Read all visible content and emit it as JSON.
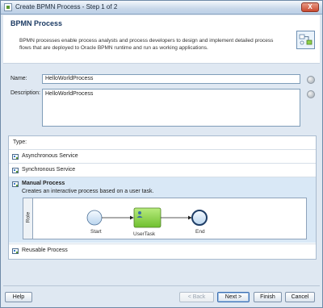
{
  "window": {
    "title": "Create BPMN Process - Step 1 of 2",
    "close_label": "X"
  },
  "header": {
    "title": "BPMN Process",
    "description": "BPMN processes enable process analysts and process developers to design and implement detailed process flows that are deployed to Oracle BPMN runtime and run as working applications."
  },
  "form": {
    "name_label": "Name:",
    "name_value": "HelloWorldProcess",
    "description_label": "Description:",
    "description_value": "HelloWorldProcess"
  },
  "type_panel": {
    "label": "Type:",
    "options": [
      {
        "label": "Asynchronous Service"
      },
      {
        "label": "Synchronous Service"
      },
      {
        "label": "Manual Process",
        "description": "Creates an interactive process based on a user task.",
        "selected": true
      },
      {
        "label": "Reusable Process"
      }
    ],
    "preview": {
      "lane_label": "Role",
      "start_label": "Start",
      "task_label": "UserTask",
      "end_label": "End"
    }
  },
  "footer": {
    "help": "Help",
    "back": "< Back",
    "next": "Next >",
    "finish": "Finish",
    "cancel": "Cancel"
  },
  "colors": {
    "accent_blue": "#d9e8f6",
    "task_green": "#8ed24a",
    "header_title": "#1b3a63"
  }
}
